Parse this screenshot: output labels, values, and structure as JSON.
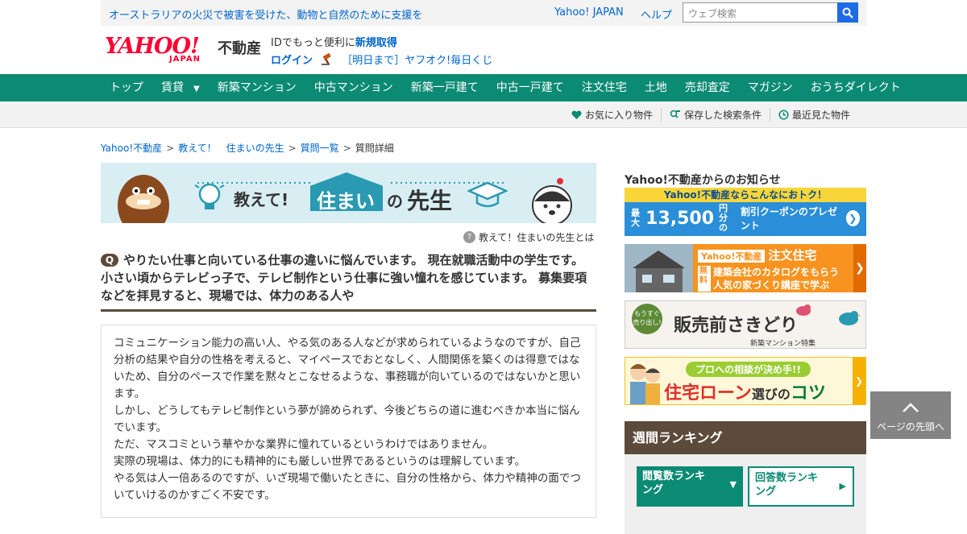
{
  "topbar": {
    "notice": "オーストラリアの火災で被害を受けた、動物と自然のために支援を",
    "yahoo_japan": "Yahoo! JAPAN",
    "help": "ヘルプ",
    "search_placeholder": "ウェブ検索"
  },
  "logo": {
    "yahoo": "YAHOO!",
    "japan": "JAPAN",
    "fudosan": "不動産"
  },
  "account": {
    "line1_text": "IDでもっと便利に",
    "register": "新規取得",
    "login": "ログイン",
    "auction": "［明日まで］ヤフオク!毎日くじ"
  },
  "nav": {
    "items": [
      "トップ",
      "賃貸",
      "新築マンション",
      "中古マンション",
      "新築一戸建て",
      "中古一戸建て",
      "注文住宅",
      "土地",
      "売却査定",
      "マガジン",
      "おうちダイレクト"
    ]
  },
  "subnav": {
    "favorites": "お気に入り物件",
    "saved_search": "保存した検索条件",
    "recently_viewed": "最近見た物件"
  },
  "breadcrumb": {
    "items": [
      "Yahoo!不動産",
      "教えて！　住まいの先生",
      "質問一覧"
    ],
    "current": "質問詳細",
    "separator": ">"
  },
  "banner": {
    "prefix": "教えて!",
    "main": "住まい",
    "no": "の",
    "suffix": "先生"
  },
  "whatis": "教えて！住まいの先生とは",
  "question": {
    "badge": "Q",
    "title": "やりたい仕事と向いている仕事の違いに悩んでいます。 現在就職活動中の学生です。 小さい頃からテレビっ子で、テレビ制作という仕事に強い憧れを感じています。 募集要項などを拝見すると、現場では、体力のある人や",
    "body": [
      "コミュニケーション能力の高い人、やる気のある人などが求められているようなのですが、自己分析の結果や自分の性格を考えると、マイペースでおとなしく、人間関係を築くのは得意ではないため、自分のペースで作業を黙々とこなせるような、事務職が向いているのではないかと思います。",
      "しかし、どうしてもテレビ制作という夢が諦められず、今後どちらの道に進むべきか本当に悩んでいます。",
      "ただ、マスコミという華やかな業界に憧れているというわけではありません。",
      "実際の現場は、体力的にも精神的にも厳しい世界であるというのは理解しています。",
      "やる気は人一倍あるのですが、いざ現場で働いたときに、自分の性格から、体力や精神の面でついていけるのかすごく不安です。"
    ]
  },
  "sidebar": {
    "news_title": "Yahoo!不動産からのお知らせ",
    "ad1": {
      "top": "Yahoo!不動産ならこんなにおトク！",
      "max": "最大",
      "amount": "13,500",
      "unit": "円分の",
      "text": "割引クーポンのプレゼント"
    },
    "ad2": {
      "brand": "Yahoo!不動産",
      "label": "注文住宅",
      "free": "無料",
      "line1": "建築会社のカタログをもらう",
      "line2": "人気の家づくり講座で学ぶ"
    },
    "ad3": {
      "soon": "もうすぐ売り出し!",
      "title": "販売前さきどり",
      "sub": "新築マンション特集"
    },
    "ad4": {
      "pill": "プロへの相談が決め手!!",
      "t1": "住宅ローン",
      "t2": "選びの",
      "t3": "コツ"
    },
    "ranking": {
      "title": "週間ランキング",
      "tab1": "閲覧数ランキング",
      "tab2": "回答数ランキング"
    }
  },
  "totop": "ページの先頭へ"
}
